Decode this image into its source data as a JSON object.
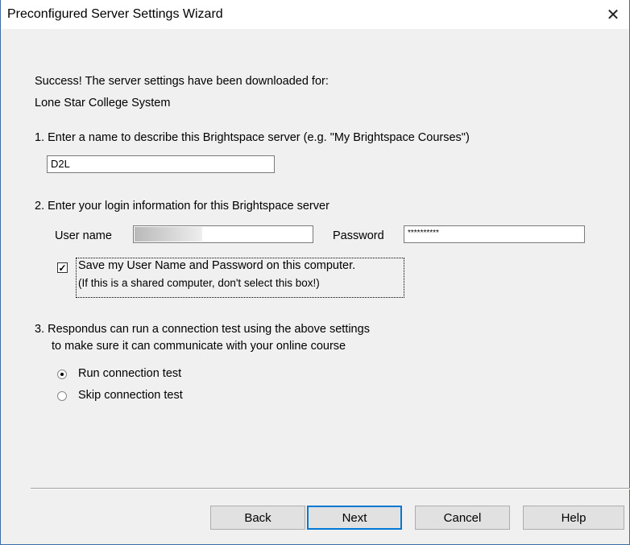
{
  "window": {
    "title": "Preconfigured Server Settings Wizard",
    "close_glyph": "✕"
  },
  "success": {
    "line1": "Success! The server settings have been downloaded for:",
    "line2": "Lone Star College System"
  },
  "step1": {
    "label": "1.  Enter a name to describe this Brightspace server (e.g. \"My Brightspace Courses\")",
    "value": "D2L"
  },
  "step2": {
    "label": "2.  Enter your login information for this Brightspace server",
    "username_label": "User name",
    "password_label": "Password",
    "password_value": "**********",
    "save_checkbox": {
      "checked": true,
      "line1": "Save my User Name and Password on this computer.",
      "line2": "(If this is a shared computer, don't select this box!)"
    }
  },
  "step3": {
    "label_line1": "3.  Respondus can run a connection test using the above settings",
    "label_line2": "to make sure it can communicate with your online course",
    "options": [
      {
        "label": "Run connection test",
        "selected": true
      },
      {
        "label": "Skip connection test",
        "selected": false
      }
    ]
  },
  "buttons": {
    "back": "Back",
    "next": "Next",
    "cancel": "Cancel",
    "help": "Help"
  }
}
